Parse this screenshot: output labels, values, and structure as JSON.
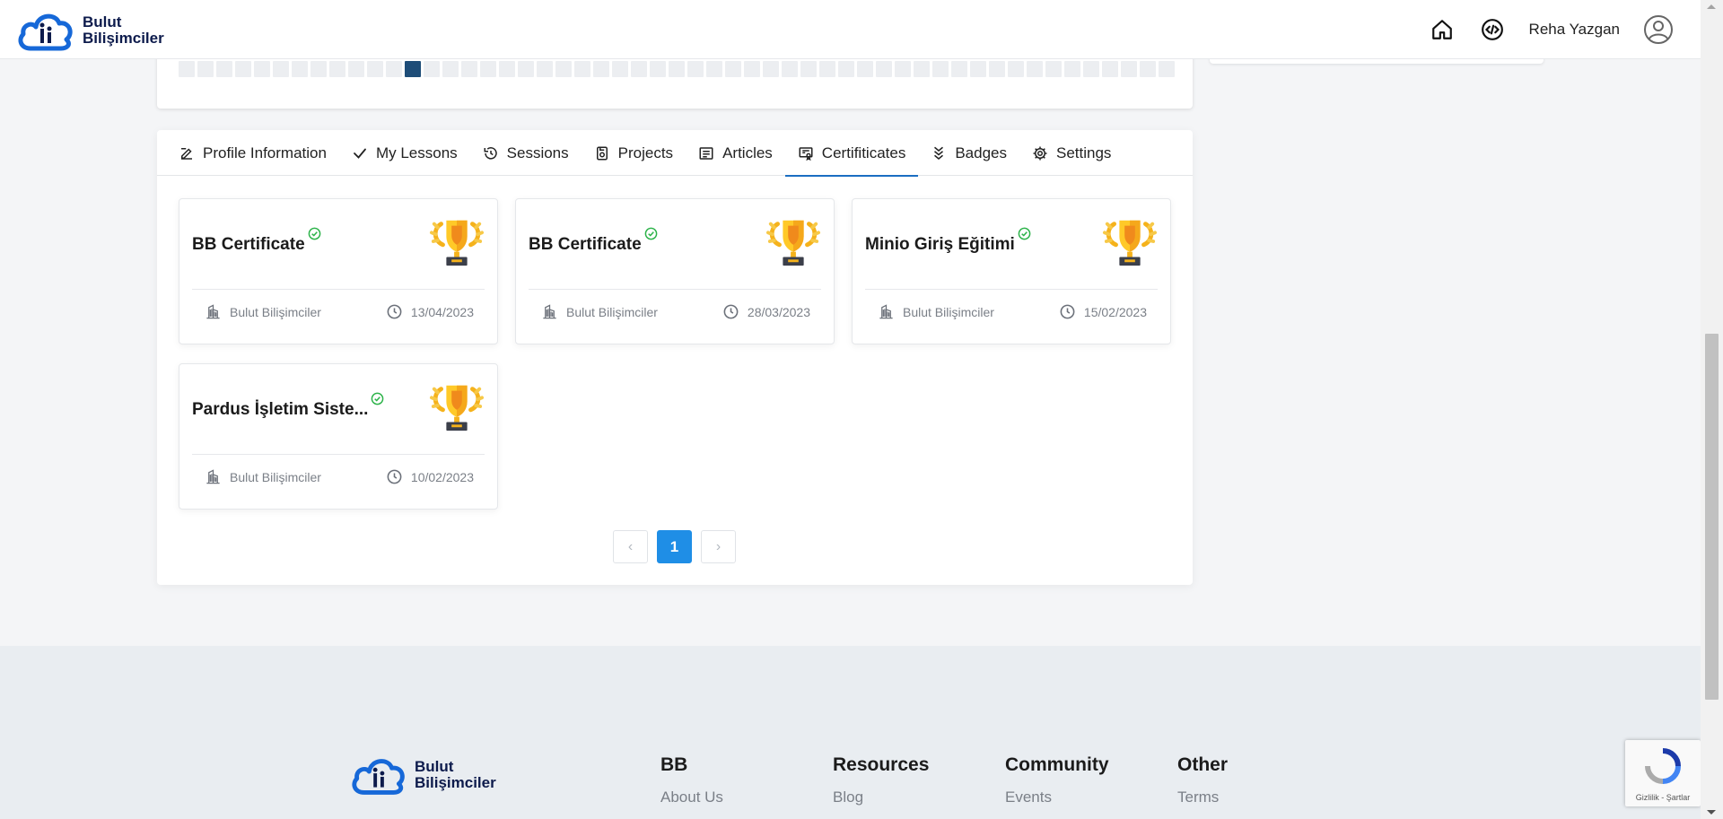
{
  "header": {
    "brand_line1": "Bulut",
    "brand_line2": "Bilişimciler",
    "username": "Reha Yazgan"
  },
  "activity": {
    "total_squares": 53,
    "active_index": 12
  },
  "tabs": [
    {
      "id": "profile",
      "label": "Profile Information",
      "icon": "edit-icon"
    },
    {
      "id": "lessons",
      "label": "My Lessons",
      "icon": "check-icon"
    },
    {
      "id": "sessions",
      "label": "Sessions",
      "icon": "history-icon"
    },
    {
      "id": "projects",
      "label": "Projects",
      "icon": "project-icon"
    },
    {
      "id": "articles",
      "label": "Articles",
      "icon": "article-icon"
    },
    {
      "id": "certificates",
      "label": "Certifiticates",
      "icon": "certificate-icon"
    },
    {
      "id": "badges",
      "label": "Badges",
      "icon": "badge-icon"
    },
    {
      "id": "settings",
      "label": "Settings",
      "icon": "gear-icon"
    }
  ],
  "active_tab": "certificates",
  "certificates": [
    {
      "title": "BB Certificate",
      "issuer": "Bulut Bilişimciler",
      "date": "13/04/2023"
    },
    {
      "title": "BB Certificate",
      "issuer": "Bulut Bilişimciler",
      "date": "28/03/2023"
    },
    {
      "title": "Minio Giriş Eğitimi",
      "issuer": "Bulut Bilişimciler",
      "date": "15/02/2023"
    },
    {
      "title": "Pardus İşletim Siste...",
      "issuer": "Bulut Bilişimciler",
      "date": "10/02/2023"
    }
  ],
  "pagination": {
    "prev": "‹",
    "current": "1",
    "next": "›"
  },
  "footer": {
    "brand_line1": "Bulut",
    "brand_line2": "Bilişimciler",
    "columns": [
      {
        "title": "BB",
        "first_link": "About Us"
      },
      {
        "title": "Resources",
        "first_link": "Blog"
      },
      {
        "title": "Community",
        "first_link": "Events"
      },
      {
        "title": "Other",
        "first_link": "Terms"
      }
    ]
  },
  "recaptcha": {
    "text": "Gizlilik - Şartlar"
  },
  "colors": {
    "accent": "#1b6ec2",
    "pager_active": "#1f8ee6",
    "activity_active": "#1e4d78",
    "verified": "#2db34a",
    "brand_navy": "#0d1b4c"
  }
}
